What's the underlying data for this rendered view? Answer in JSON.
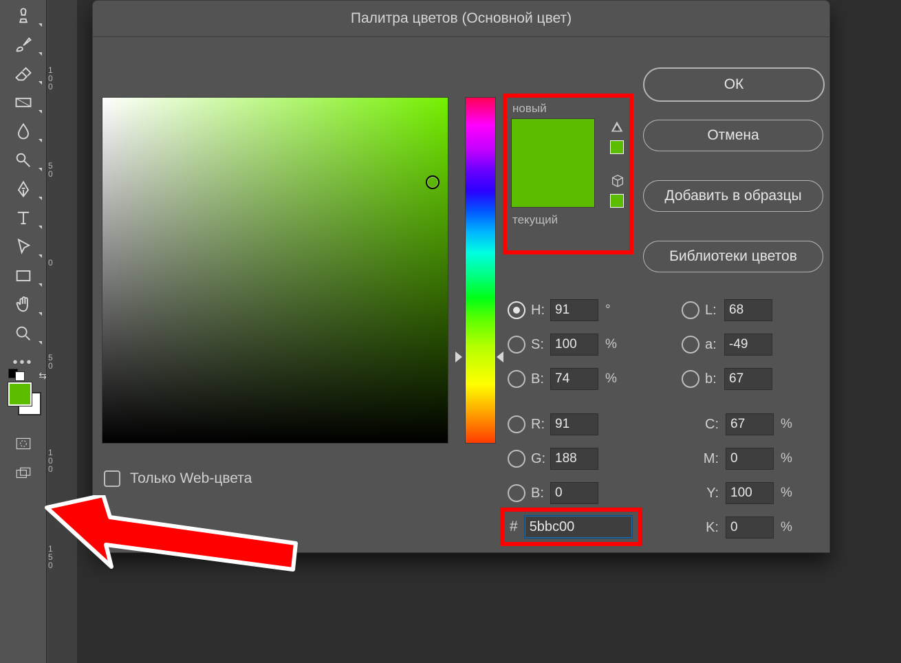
{
  "dialog": {
    "title": "Палитра цветов (Основной цвет)",
    "preview_new": "новый",
    "preview_current": "текущий",
    "web_only": "Только Web-цвета",
    "hex_symbol": "#",
    "hex_value": "5bbc00",
    "new_color": "#5bbc00",
    "current_color": "#5bbc00",
    "buttons": {
      "ok": "ОК",
      "cancel": "Отмена",
      "add": "Добавить в образцы",
      "libs": "Библиотеки цветов"
    },
    "hsb": {
      "h_label": "H:",
      "h": "91",
      "h_unit": "°",
      "s_label": "S:",
      "s": "100",
      "s_unit": "%",
      "b_label": "B:",
      "b": "74",
      "b_unit": "%"
    },
    "rgb": {
      "r_label": "R:",
      "r": "91",
      "g_label": "G:",
      "g": "188",
      "b_label": "B:",
      "b": "0"
    },
    "lab": {
      "l_label": "L:",
      "l": "68",
      "a_label": "a:",
      "a": "-49",
      "b_label": "b:",
      "b": "67"
    },
    "cmyk": {
      "c_label": "C:",
      "c": "67",
      "m_label": "M:",
      "m": "0",
      "y_label": "Y:",
      "y": "100",
      "k_label": "K:",
      "k": "0",
      "unit": "%"
    }
  },
  "ruler": {
    "t1": "1 0 0",
    "t2": "5 0",
    "t3": "0",
    "t4": "5 0",
    "t5": "1 0 0",
    "t6": "1 5 0"
  },
  "tools": [
    "stamp",
    "brush",
    "eraser",
    "gradient",
    "blur",
    "dodge",
    "pen",
    "type",
    "path-select",
    "rectangle",
    "hand",
    "zoom",
    "more"
  ]
}
